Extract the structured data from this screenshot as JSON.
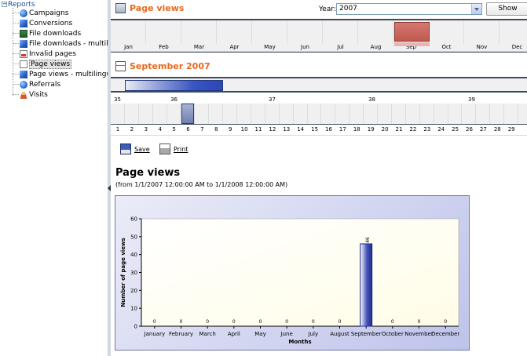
{
  "tree": {
    "root_label": "Reports",
    "items": [
      {
        "label": "Campaigns",
        "icon": "globe-icon"
      },
      {
        "label": "Conversions",
        "icon": "cube-icon"
      },
      {
        "label": "File downloads",
        "icon": "download-icon"
      },
      {
        "label": "File downloads - multilingual",
        "icon": "cube-icon"
      },
      {
        "label": "Invalid pages",
        "icon": "invalid-page-icon"
      },
      {
        "label": "Page views",
        "icon": "page-icon",
        "selected": true
      },
      {
        "label": "Page views - multilingual",
        "icon": "cube-icon"
      },
      {
        "label": "Referrals",
        "icon": "globe-icon"
      },
      {
        "label": "Visits",
        "icon": "person-icon"
      }
    ]
  },
  "header": {
    "title": "Page views",
    "year_label": "Year:",
    "year_value": "2007",
    "show_label": "Show"
  },
  "months": [
    "Jan",
    "Feb",
    "Mar",
    "Apr",
    "May",
    "Jun",
    "Jul",
    "Aug",
    "Sep",
    "Oct",
    "Nov",
    "Dec"
  ],
  "selected_month_index": 8,
  "month_header": {
    "title": "September 2007"
  },
  "weeks": [
    "35",
    "36",
    "37",
    "38",
    "39"
  ],
  "days": [
    "1",
    "2",
    "3",
    "4",
    "5",
    "6",
    "7",
    "8",
    "9",
    "10",
    "11",
    "12",
    "13",
    "14",
    "15",
    "16",
    "17",
    "18",
    "19",
    "20",
    "21",
    "22",
    "23",
    "24",
    "25",
    "26",
    "27",
    "28",
    "29"
  ],
  "selected_day": "6",
  "toolbar": {
    "save_label": "Save",
    "print_label": "Print"
  },
  "report": {
    "title": "Page views",
    "subtitle": "(from 1/1/2007 12:00:00 AM to 1/1/2008 12:00:00 AM)"
  },
  "chart_data": {
    "type": "bar",
    "categories": [
      "January",
      "February",
      "March",
      "April",
      "May",
      "June",
      "July",
      "August",
      "September",
      "October",
      "November",
      "December"
    ],
    "values": [
      0,
      0,
      0,
      0,
      0,
      0,
      0,
      0,
      46,
      0,
      0,
      0
    ],
    "data_labels": [
      "0",
      "0",
      "0",
      "0",
      "0",
      "0",
      "0",
      "0",
      "46",
      "0",
      "0",
      "0"
    ],
    "xlabel": "Months",
    "ylabel": "Number of page views",
    "ylim": [
      0,
      60
    ],
    "yticks": [
      0,
      10,
      20,
      30,
      40,
      50,
      60
    ],
    "grid": false,
    "colors": {
      "bar": "#1d2a8c",
      "plot_bg": "#fffde7",
      "frame_bg": "#c4c8ee"
    }
  }
}
